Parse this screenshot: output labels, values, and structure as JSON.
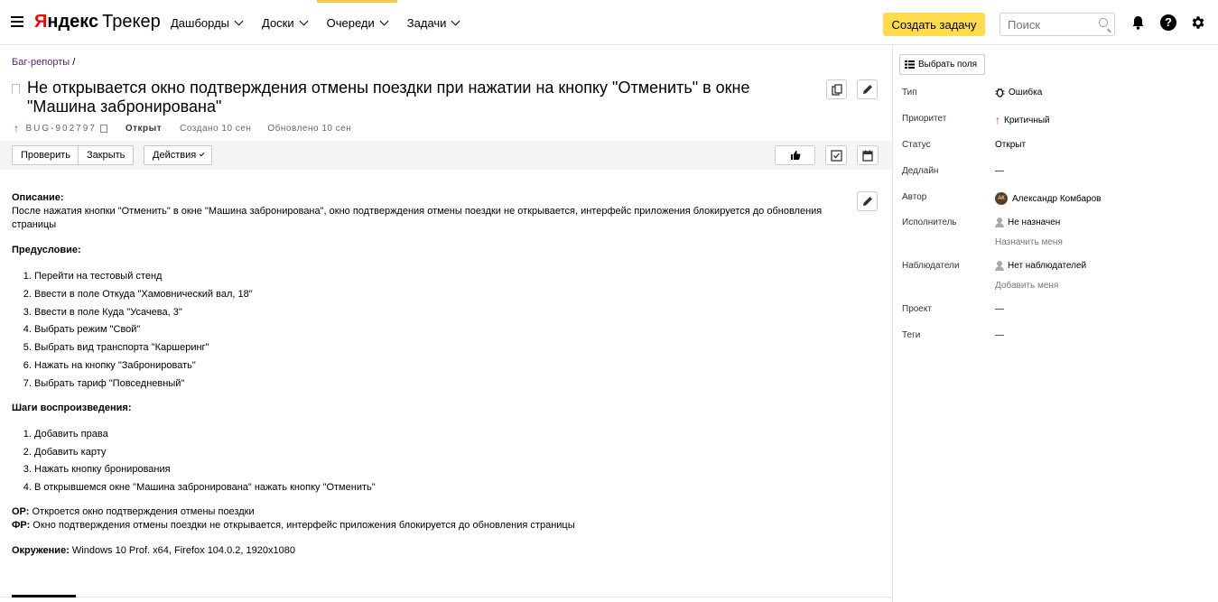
{
  "header": {
    "logo_ya": "Я",
    "logo_ya_rest": "ндекс",
    "logo_product": "Трекер",
    "nav": [
      {
        "label": "Дашборды"
      },
      {
        "label": "Доски"
      },
      {
        "label": "Очереди"
      },
      {
        "label": "Задачи"
      }
    ],
    "active_nav": "Очереди",
    "create_label": "Создать задачу",
    "search_placeholder": "Поиск",
    "help_glyph": "?",
    "accent_color": "#ffdb4d"
  },
  "issue": {
    "breadcrumb": "Баг-репорты",
    "breadcrumb_sep": "/",
    "title": "Не открывается окно подтверждения отмены поездки при нажатии на кнопку \"Отменить\" в окне \"Машина забронирована\"",
    "priority_arrow": "↑",
    "key": "BUG-902797",
    "status": "Открыт",
    "created": "Создано 10 сен",
    "updated": "Обновлено 10 сен"
  },
  "toolbar": {
    "check_label": "Проверить",
    "close_label": "Закрыть",
    "actions_label": "Действия"
  },
  "description": {
    "desc_heading": "Описание:",
    "desc_text": "После нажатия кнопки \"Отменить\" в окне \"Машина забронирована\", окно подтверждения отмены поездки не открывается, интерфейс приложения блокируется до обновления страницы",
    "pre_heading": "Предусловие:",
    "pre_steps": [
      "Перейти на тестовый стенд",
      "Ввести в поле Откуда \"Хамовнический вал, 18\"",
      "Ввести в поле Куда \"Усачева, 3\"",
      "Выбрать режим \"Свой\"",
      "Выбрать вид транспорта \"Каршеринг\"",
      "Нажать на кнопку \"Забронировать\"",
      "Выбрать тариф \"Повседневный\""
    ],
    "steps_heading": "Шаги воспроизведения:",
    "steps": [
      "Добавить права",
      "Добавить карту",
      "Нажать кнопку бронирования",
      "В открывшемся окне \"Машина забронирована\" нажать кнопку \"Отменить\""
    ],
    "expected_label": "ОР:",
    "expected_text": " Откроется окно подтверждения отмены поездки",
    "actual_label": "ФР:",
    "actual_text": " Окно подтверждения отмены поездки не открывается, интерфейс приложения блокируется до обновления страницы",
    "env_label": "Окружение:",
    "env_text": " Windows 10 Prof. x64, Firefox 104.0.2, 1920x1080"
  },
  "sidebar": {
    "fields_button": "Выбрать поля",
    "type_label": "Тип",
    "type_value": "Ошибка",
    "priority_label": "Приоритет",
    "priority_value": "Критичный",
    "status_label": "Статус",
    "status_value": "Открыт",
    "deadline_label": "Дедлайн",
    "deadline_value": "—",
    "author_label": "Автор",
    "author_initials": "АК",
    "author_value": "Александр Комбаров",
    "assignee_label": "Исполнитель",
    "assignee_value": "Не назначен",
    "assign_me": "Назначить меня",
    "followers_label": "Наблюдатели",
    "followers_value": "Нет наблюдателей",
    "add_me": "Добавить меня",
    "project_label": "Проект",
    "project_value": "—",
    "tags_label": "Теги",
    "tags_value": "—"
  }
}
